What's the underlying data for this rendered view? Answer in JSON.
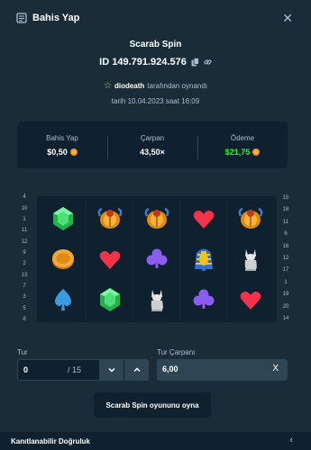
{
  "header": {
    "title": "Bahis Yap",
    "close_icon": "close-icon",
    "bet_icon": "bet-slip-icon"
  },
  "game": {
    "title": "Scarab Spin",
    "id_text": "ID 149.791.924.576",
    "player_name": "diodeath",
    "player_suffix": "tarafından oynandı",
    "date_text": "tarih 10.04.2023 saat 16:09"
  },
  "stats": {
    "bet_label": "Bahis Yap",
    "bet_value": "$0,50",
    "multiplier_label": "Çarpan",
    "multiplier_value": "43,50×",
    "payout_label": "Ödeme",
    "payout_value": "$21,75",
    "payout_color": "#1fff20"
  },
  "board": {
    "lines_left": [
      "4",
      "10",
      "1",
      "11",
      "12",
      "9",
      "2",
      "13",
      "7",
      "3",
      "5",
      "8"
    ],
    "lines_right": [
      "15",
      "18",
      "11",
      "6",
      "16",
      "12",
      "17",
      "1",
      "19",
      "20",
      "14"
    ],
    "rows": [
      [
        "emerald-icon",
        "scarab-icon",
        "scarab-icon",
        "heart-icon",
        "scarab-icon"
      ],
      [
        "coin-icon",
        "heart-icon",
        "club-icon",
        "pharaoh-icon",
        "cat-statue-icon"
      ],
      [
        "spade-icon",
        "emerald-icon",
        "cat-statue-icon",
        "club-icon",
        "heart-icon"
      ]
    ]
  },
  "controls": {
    "rounds_label": "Tur",
    "rounds_value": "0",
    "rounds_max": "/ 15",
    "multiplier_label": "Tur Çarpanı",
    "multiplier_value": "6,00",
    "clear_label": "X",
    "play_label": "Scarab Spin oyununu oyna"
  },
  "footer": {
    "label": "Kanıtlanabilir Doğruluk"
  }
}
